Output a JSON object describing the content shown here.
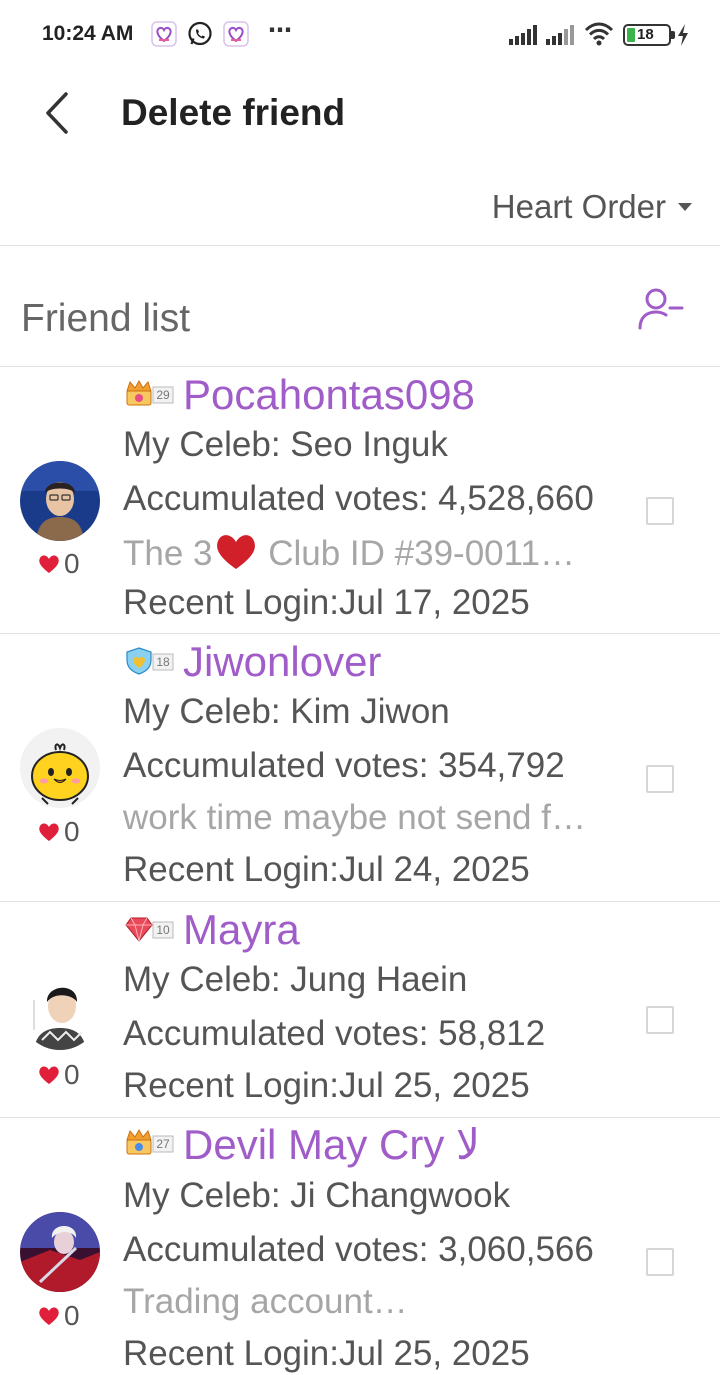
{
  "status_bar": {
    "time": "10:24 AM",
    "battery": "18",
    "icons": [
      "heart-app-icon",
      "whatsapp-icon",
      "heart-app-icon",
      "more-dots-icon",
      "signal-icon",
      "signal-icon",
      "wifi-icon",
      "battery-icon",
      "charging-icon"
    ],
    "dots": "⋯"
  },
  "app_bar": {
    "title": "Delete friend",
    "back_icon": "back-arrow-icon"
  },
  "sort": {
    "label": "Heart Order",
    "icon": "caret-down-icon"
  },
  "list_header": {
    "title": "Friend list",
    "action_icon": "remove-user-icon"
  },
  "colors": {
    "accent": "#a05cc8",
    "muted_text": "#a6a6a6",
    "heart": "#e0203a",
    "divider": "#e2e2e2"
  },
  "friends": [
    {
      "name": "Pocahontas098",
      "level": "29",
      "badge_icon": "crown-badge-icon",
      "celeb": "My Celeb: Seo Inguk",
      "votes": "Accumulated votes: 4,528,660",
      "message_pre": "The 3",
      "message_post": " Club ID #39-0011…",
      "login": "Recent Login:Jul 17, 2025",
      "hearts": "0"
    },
    {
      "name": "Jiwonlover",
      "level": "18",
      "badge_icon": "heart-shield-badge-icon",
      "celeb": "My Celeb: Kim Jiwon",
      "votes": "Accumulated votes: 354,792",
      "message": "work time maybe not send f…",
      "login": "Recent Login:Jul 24, 2025",
      "hearts": "0"
    },
    {
      "name": "Mayra",
      "level": "10",
      "badge_icon": "gem-badge-icon",
      "celeb": "My Celeb: Jung Haein",
      "votes": "Accumulated votes: 58,812",
      "login": "Recent Login:Jul 25, 2025",
      "hearts": "0"
    },
    {
      "name": "Devil May Cry لا",
      "level": "27",
      "badge_icon": "crown-badge-icon",
      "celeb": "My Celeb: Ji Changwook",
      "votes": "Accumulated votes: 3,060,566",
      "message": "Trading account…",
      "login": "Recent Login:Jul 25, 2025",
      "hearts": "0"
    }
  ]
}
